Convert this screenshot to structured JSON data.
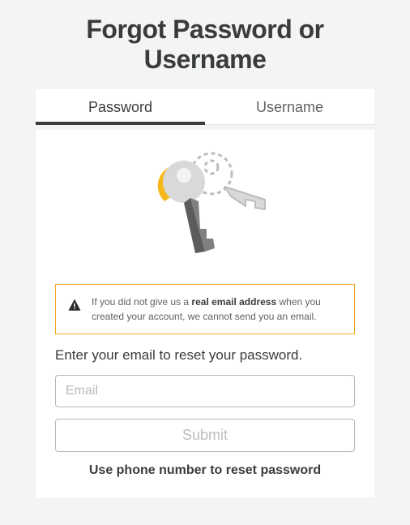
{
  "title": "Forgot Password or Username",
  "tabs": {
    "password": "Password",
    "username": "Username"
  },
  "alert": {
    "prefix": "If you did not give us a ",
    "bold": "real email address",
    "suffix": " when you created your account, we cannot send you an email."
  },
  "instruction": "Enter your email to reset your password.",
  "email_placeholder": "Email",
  "submit_label": "Submit",
  "phone_link": "Use phone number to reset password"
}
